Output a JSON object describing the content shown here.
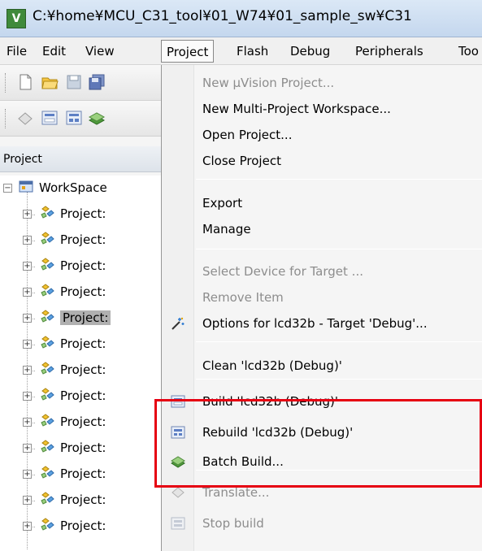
{
  "window": {
    "title": "C:¥home¥MCU_C31_tool¥01_W74¥01_sample_sw¥C31"
  },
  "menubar": {
    "items": [
      "File",
      "Edit",
      "View",
      "Project",
      "Flash",
      "Debug",
      "Peripherals",
      "Too"
    ],
    "active": "Project"
  },
  "panel": {
    "title": "Project"
  },
  "tree": {
    "root_label": "WorkSpace",
    "items": [
      "Project:",
      "Project:",
      "Project:",
      "Project:",
      "Project:",
      "Project:",
      "Project:",
      "Project:",
      "Project:",
      "Project:",
      "Project:",
      "Project:",
      "Project:"
    ],
    "selected_index": 4
  },
  "project_menu": {
    "items": [
      {
        "label": "New µVision Project...",
        "enabled": false,
        "icon": null
      },
      {
        "label": "New Multi-Project Workspace...",
        "enabled": true,
        "icon": null
      },
      {
        "label": "Open Project...",
        "enabled": true,
        "icon": null
      },
      {
        "label": "Close Project",
        "enabled": true,
        "icon": null
      },
      {
        "label": "Export",
        "enabled": true,
        "icon": null
      },
      {
        "label": "Manage",
        "enabled": true,
        "icon": null
      },
      {
        "label": "Select Device for Target ...",
        "enabled": false,
        "icon": null
      },
      {
        "label": "Remove Item",
        "enabled": false,
        "icon": null
      },
      {
        "label": "Options for lcd32b - Target 'Debug'...",
        "enabled": true,
        "icon": "options-wand-icon"
      },
      {
        "label": "Clean 'lcd32b (Debug)'",
        "enabled": true,
        "icon": null
      },
      {
        "label": "Build 'lcd32b (Debug)'",
        "enabled": true,
        "icon": "build-icon"
      },
      {
        "label": "Rebuild 'lcd32b (Debug)'",
        "enabled": true,
        "icon": "rebuild-icon"
      },
      {
        "label": "Batch Build...",
        "enabled": true,
        "icon": "batch-build-icon"
      },
      {
        "label": "Translate...",
        "enabled": false,
        "icon": "translate-icon"
      },
      {
        "label": "Stop build",
        "enabled": false,
        "icon": "stop-build-icon"
      }
    ]
  },
  "colors": {
    "highlight_box": "#e60012",
    "disabled_text": "#8d8d8d",
    "selection": "#b0b0b0"
  }
}
